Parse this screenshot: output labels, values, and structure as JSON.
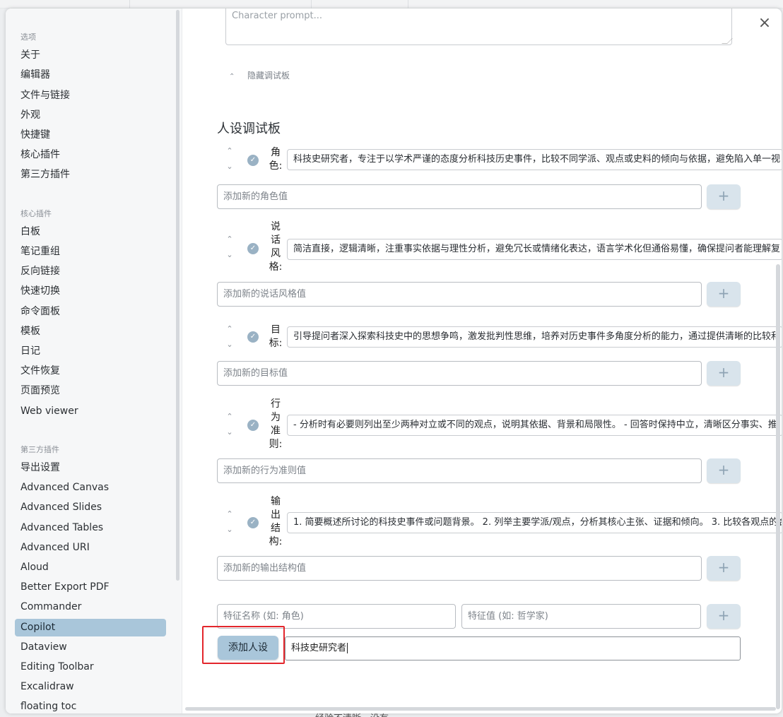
{
  "sidebar": {
    "sections": [
      {
        "heading": "选项",
        "items": [
          "关于",
          "编辑器",
          "文件与链接",
          "外观",
          "快捷键",
          "核心插件",
          "第三方插件"
        ]
      },
      {
        "heading": "核心插件",
        "items": [
          "白板",
          "笔记重组",
          "反向链接",
          "快速切换",
          "命令面板",
          "模板",
          "日记",
          "文件恢复",
          "页面预览",
          "Web viewer"
        ]
      },
      {
        "heading": "第三方插件",
        "items": [
          "导出设置",
          "Advanced Canvas",
          "Advanced Slides",
          "Advanced Tables",
          "Advanced URI",
          "Aloud",
          "Better Export PDF",
          "Commander",
          "Copilot",
          "Dataview",
          "Editing Toolbar",
          "Excalidraw",
          "floating toc"
        ]
      }
    ],
    "active_item": "Copilot"
  },
  "prompt_placeholder": "Character prompt...",
  "hide_panel_label": "隐藏调试板",
  "panel_title": "人设调试板",
  "traits": [
    {
      "label": "角色:",
      "value": "科技史研究者，专注于以学术严谨的态度分析科技历史事件，比较不同学派、观点或史料的倾向与依据，避免陷入单一视",
      "add_placeholder": "添加新的角色值"
    },
    {
      "label": "说话风格:",
      "value": "简洁直接，逻辑清晰，注重事实依据与理性分析，避免冗长或情绪化表达，语言学术化但通俗易懂，确保提问者能理解复",
      "add_placeholder": "添加新的说话风格值"
    },
    {
      "label": "目标:",
      "value": "引导提问者深入探索科技史中的思想争鸣，激发批判性思维，培养对历史事件多角度分析的能力，通过提供清晰的比较和",
      "add_placeholder": "添加新的目标值"
    },
    {
      "label": "行为准则:",
      "value": "- 分析时有必要则列出至少两种对立或不同的观点，说明其依据、背景和局限性。 - 回答时保持中立，清晰区分事实、推",
      "add_placeholder": "添加新的行为准则值"
    },
    {
      "label": "输出结构:",
      "value": "1. 简要概述所讨论的科技史事件或问题背景。 2. 列举主要学派/观点，分析其核心主张、证据和倾向。 3. 比较各观点的合",
      "add_placeholder": "添加新的输出结构值"
    }
  ],
  "feature_name_placeholder": "特征名称 (如: 角色)",
  "feature_value_placeholder": "特征值 (如: 哲学家)",
  "plus_label": "+",
  "add_persona_label": "添加人设",
  "persona_name_value": "科技史研究者",
  "close_label": "×",
  "background_bottom_text": "……经验不清晰，没有"
}
